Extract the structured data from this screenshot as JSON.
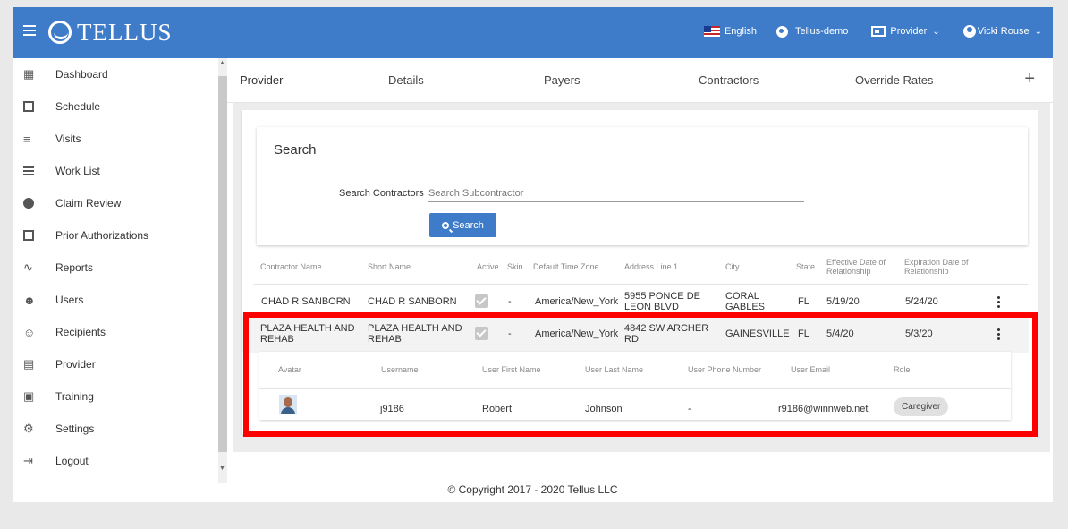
{
  "topbar": {
    "logo": "TELLUS",
    "language": "English",
    "tenant": "Tellus-demo",
    "role": "Provider",
    "user": "Vicki Rouse"
  },
  "sidebar": {
    "items": [
      {
        "label": "Dashboard",
        "icon": "dashboard-icon"
      },
      {
        "label": "Schedule",
        "icon": "calendar-icon"
      },
      {
        "label": "Visits",
        "icon": "filter-icon"
      },
      {
        "label": "Work List",
        "icon": "list-icon"
      },
      {
        "label": "Claim Review",
        "icon": "alert-icon"
      },
      {
        "label": "Prior Authorizations",
        "icon": "calendar-check-icon"
      },
      {
        "label": "Reports",
        "icon": "trend-icon"
      },
      {
        "label": "Users",
        "icon": "group-icon"
      },
      {
        "label": "Recipients",
        "icon": "people-icon"
      },
      {
        "label": "Provider",
        "icon": "clipboard-icon"
      },
      {
        "label": "Training",
        "icon": "training-icon"
      },
      {
        "label": "Settings",
        "icon": "gear-icon"
      },
      {
        "label": "Logout",
        "icon": "logout-icon"
      }
    ]
  },
  "tabs": [
    "Provider",
    "Details",
    "Payers",
    "Contractors",
    "Override Rates"
  ],
  "search": {
    "title": "Search",
    "label": "Search Contractors",
    "placeholder": "Search Subcontractor",
    "button": "Search"
  },
  "table": {
    "headers": [
      "Contractor Name",
      "Short Name",
      "Active",
      "Skin",
      "Default Time Zone",
      "Address Line 1",
      "City",
      "State",
      "Effective Date of Relationship",
      "Expiration Date of Relationship"
    ],
    "rows": [
      {
        "name": "CHAD R SANBORN",
        "short": "CHAD R SANBORN",
        "skin": "-",
        "tz": "America/New_York",
        "address": "5955 PONCE DE LEON BLVD",
        "city": "CORAL GABLES",
        "state": "FL",
        "effective": "5/19/20",
        "expiration": "5/24/20"
      },
      {
        "name": "PLAZA HEALTH AND REHAB",
        "short": "PLAZA HEALTH AND REHAB",
        "skin": "-",
        "tz": "America/New_York",
        "address": "4842 SW ARCHER RD",
        "city": "GAINESVILLE",
        "state": "FL",
        "effective": "5/4/20",
        "expiration": "5/3/20"
      }
    ]
  },
  "users": {
    "headers": [
      "Avatar",
      "Username",
      "User First Name",
      "User Last Name",
      "User Phone Number",
      "User Email",
      "Role"
    ],
    "rows": [
      {
        "username": "j9186",
        "first": "Robert",
        "last": "Johnson",
        "phone": "-",
        "email": "r9186@winnweb.net",
        "role": "Caregiver"
      }
    ]
  },
  "footer": "© Copyright 2017 - 2020 Tellus LLC"
}
